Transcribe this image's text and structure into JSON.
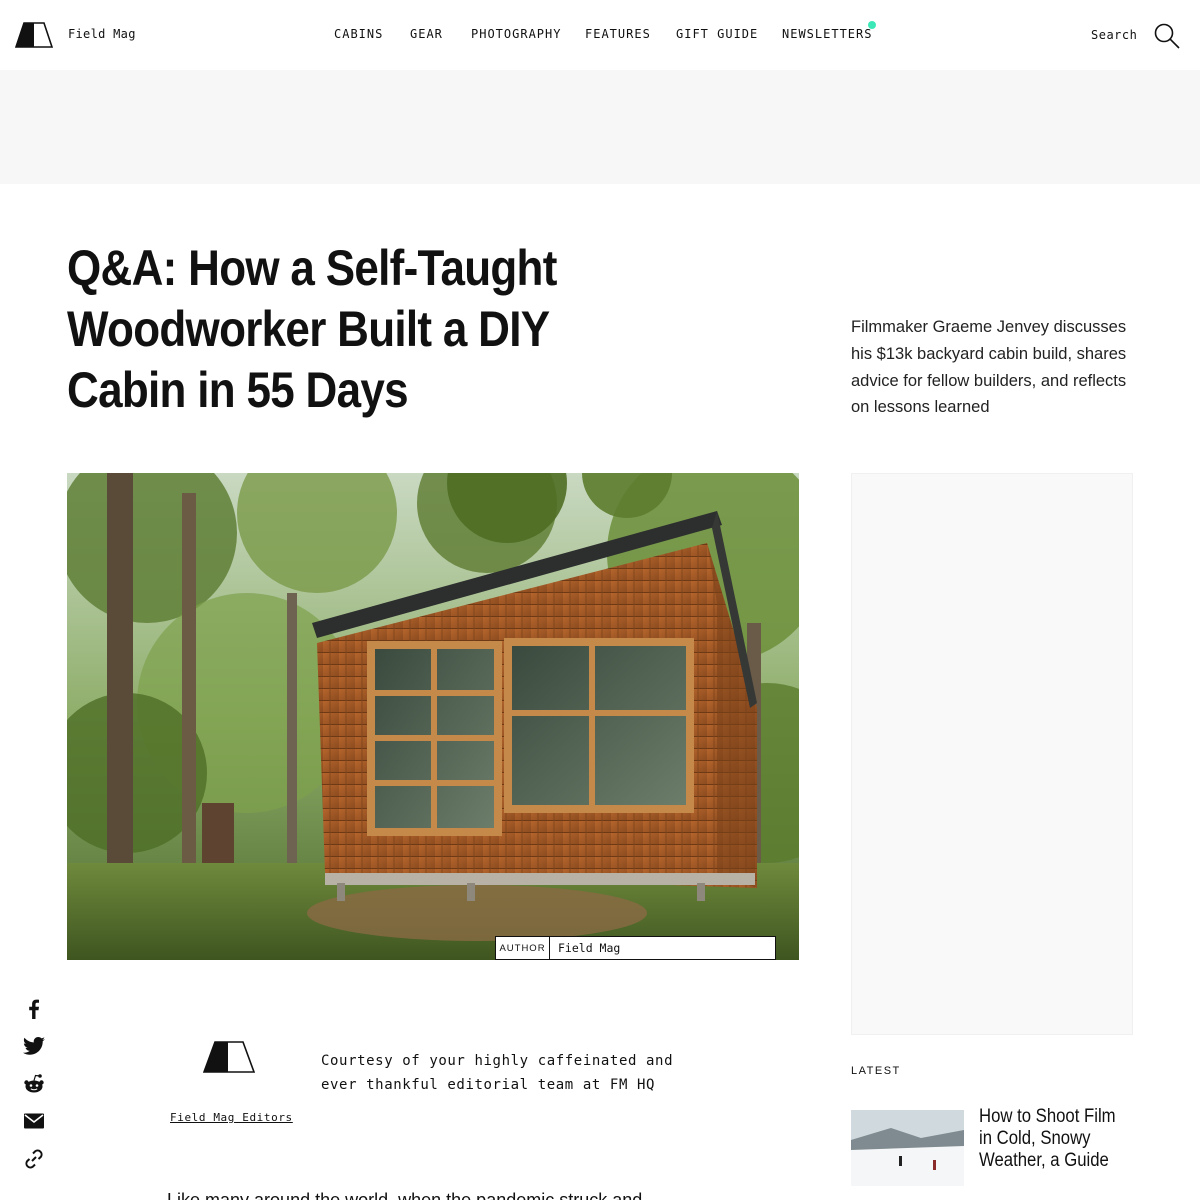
{
  "header": {
    "brand": "Field Mag",
    "nav": [
      {
        "label": "CABINS"
      },
      {
        "label": "GEAR"
      },
      {
        "label": "PHOTOGRAPHY"
      },
      {
        "label": "FEATURES"
      },
      {
        "label": "GIFT GUIDE"
      },
      {
        "label": "NEWSLETTERS"
      }
    ],
    "search_label": "Search",
    "newsletter_dot_color": "#3de8b8"
  },
  "colors": {
    "ad_band": "#f7f7f7",
    "side_ad": "#f9f9f9",
    "text": "#111111"
  },
  "article": {
    "title": "Q&A: How a Self-Taught Woodworker Built a DIY Cabin in 55 Days",
    "dek": "Filmmaker Graeme Jenvey discusses his $13k backyard cabin build, shares advice for fellow builders, and reflects on lessons learned",
    "photo_credit": {
      "label": "AUTHOR",
      "value": "Field Mag"
    },
    "author": {
      "name": "Field Mag Editors",
      "bio": "Courtesy of your highly caffeinated and ever thankful editorial team at FM HQ"
    },
    "body_first_line": "Like many around the world, when the pandemic struck and"
  },
  "share": [
    "facebook-icon",
    "twitter-icon",
    "reddit-icon",
    "email-icon",
    "link-icon"
  ],
  "latest": {
    "label": "LATEST",
    "items": [
      {
        "title": "How to Shoot Film in Cold, Snowy Weather, a Guide"
      }
    ]
  }
}
